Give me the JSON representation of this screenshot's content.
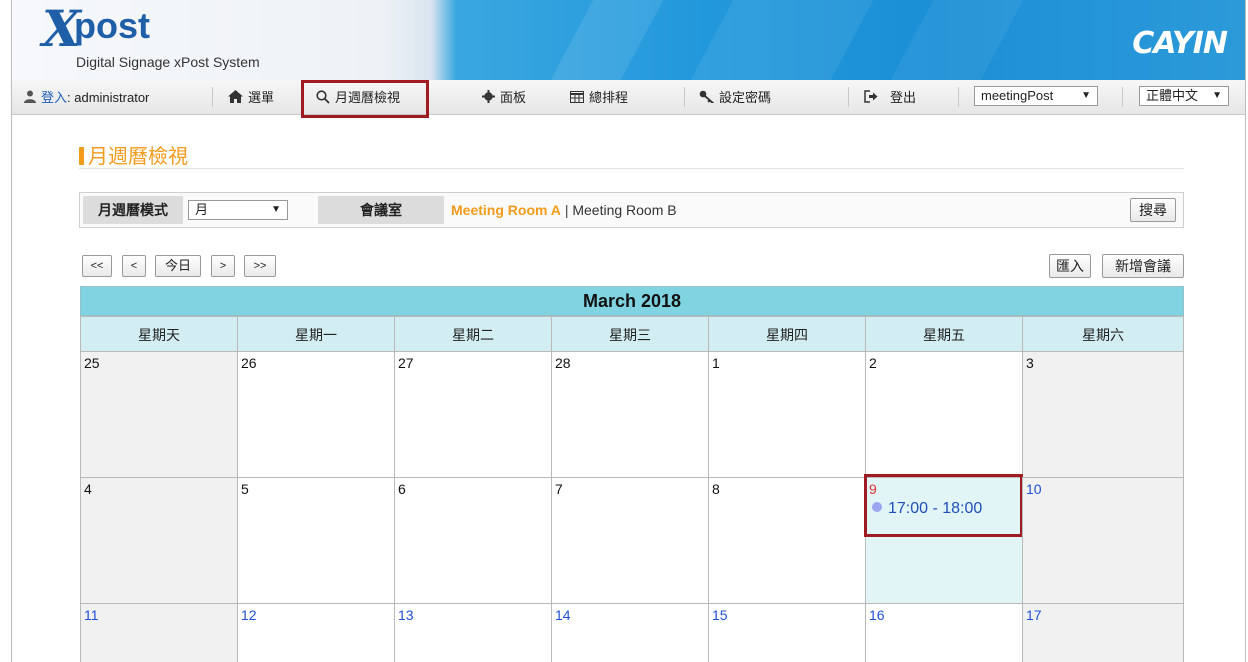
{
  "header": {
    "logo_x": "X",
    "logo_post": "post",
    "logo_subtitle": "Digital Signage xPost System",
    "brand": "CAYIN"
  },
  "nav": {
    "login_prefix": "登入",
    "login_user": ": administrator",
    "menu": "選單",
    "calendar_view": "月週曆檢視",
    "panel": "面板",
    "schedule": "總排程",
    "password": "設定密碼",
    "logout": "登出",
    "post_select": "meetingPost",
    "language_select": "正體中文"
  },
  "page": {
    "title": "月週曆檢視"
  },
  "filter": {
    "mode_label": "月週曆模式",
    "mode_value": "月",
    "room_label": "會議室",
    "room_active": "Meeting Room A",
    "room_sep": "|",
    "room_other": "Meeting Room B",
    "search_button": "搜尋"
  },
  "toolbar": {
    "first": "<<",
    "prev": "<",
    "today": "今日",
    "next": ">",
    "last": ">>",
    "import": "匯入",
    "new_meeting": "新增會議"
  },
  "calendar": {
    "month_title": "March 2018",
    "weekdays": [
      "星期天",
      "星期一",
      "星期二",
      "星期三",
      "星期四",
      "星期五",
      "星期六"
    ],
    "weeks": [
      [
        "25",
        "26",
        "27",
        "28",
        "1",
        "2",
        "3"
      ],
      [
        "4",
        "5",
        "6",
        "7",
        "8",
        "9",
        "10"
      ],
      [
        "11",
        "12",
        "13",
        "14",
        "15",
        "16",
        "17"
      ]
    ],
    "event": {
      "day": "9",
      "time": "17:00 - 18:00"
    }
  },
  "colors": {
    "accent_orange": "#f29b1d",
    "highlight_red": "#9e1b24",
    "calendar_header": "#80d4e2",
    "weekday_header": "#d3eef3",
    "today_cell": "#e1f4f6"
  }
}
